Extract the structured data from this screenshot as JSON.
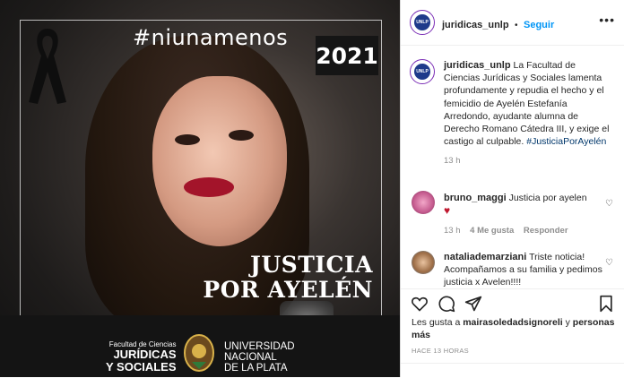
{
  "post_image": {
    "hashtag": "#niunamenos",
    "year": "2021",
    "justice_line1": "JUSTICIA",
    "justice_line2": "POR AYELÉN",
    "faculty_small": "Facultad de Ciencias",
    "faculty_line1": "JURÍDICAS",
    "faculty_line2": "Y SOCIALES",
    "university_line1": "UNIVERSIDAD",
    "university_line2": "NACIONAL",
    "university_line3": "DE LA PLATA",
    "colors": {
      "background": "#1f1f1f",
      "lips": "#a3142a"
    }
  },
  "header": {
    "username": "juridicas_unlp",
    "separator": "•",
    "follow_label": "Seguir",
    "more_icon": "more-horizontal-icon"
  },
  "caption": {
    "username": "juridicas_unlp",
    "text": "La Facultad de Ciencias Jurídicas y Sociales lamenta profundamente y repudia el hecho y el femicidio de Ayelén Estefanía Arredondo, ayudante alumna de Derecho Romano Cátedra III, y exige el castigo al culpable.",
    "hashtag": "#JusticiaPorAyelén",
    "time": "13 h"
  },
  "comments": [
    {
      "username": "bruno_maggi",
      "text": "Justicia por ayelen",
      "emoji": "♥",
      "time": "13 h",
      "likes": "4 Me gusta",
      "reply_label": "Responder"
    },
    {
      "username": "nataliademarziani",
      "text": "Triste noticia! Acompañamos a su familia y pedimos justicia x Avelen!!!!"
    }
  ],
  "actions": {
    "like_icon": "heart-icon",
    "comment_icon": "comment-icon",
    "share_icon": "send-icon",
    "save_icon": "bookmark-icon"
  },
  "likes": {
    "prefix": "Les gusta a",
    "user": "mairasoledadsignoreli",
    "connector": "y",
    "others": "personas más"
  },
  "posted_ago": "HACE 13 HORAS",
  "accent_color": "#0095f6"
}
